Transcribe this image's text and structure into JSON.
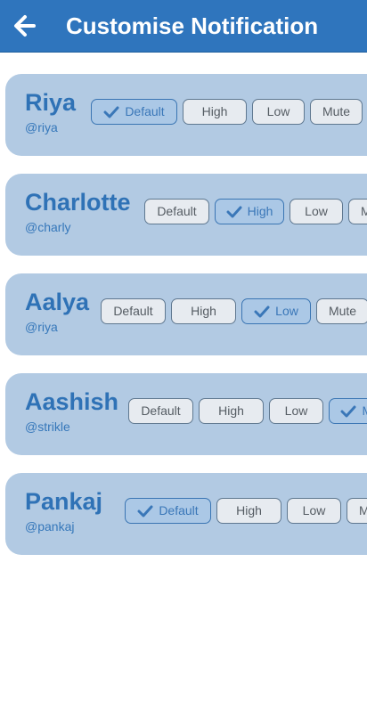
{
  "header": {
    "title": "Customise Notification",
    "back_icon": "arrow-left-icon"
  },
  "options": [
    "Default",
    "High",
    "Low",
    "Mute"
  ],
  "contacts": [
    {
      "name": "Riya",
      "handle": "@riya",
      "selected": "Default"
    },
    {
      "name": "Charlotte",
      "handle": "@charly",
      "selected": "High"
    },
    {
      "name": "Aalya",
      "handle": "@riya",
      "selected": "Low"
    },
    {
      "name": "Aashish",
      "handle": "@strikle",
      "selected": "Mute"
    },
    {
      "name": "Pankaj",
      "handle": "@pankaj",
      "selected": "Default"
    }
  ],
  "colors": {
    "app_bar": "#2f75bd",
    "card_bg": "#b2cae3",
    "accent_text": "#2f72b6",
    "option_bg": "#e7ebf0",
    "option_selected_bg": "#abc8e6"
  }
}
